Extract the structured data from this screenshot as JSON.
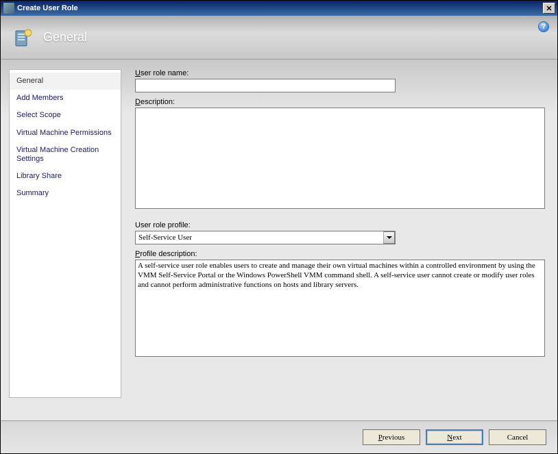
{
  "window": {
    "title": "Create User Role"
  },
  "header": {
    "title": "General",
    "help_icon": "?"
  },
  "sidebar": {
    "items": [
      {
        "label": "General",
        "selected": true
      },
      {
        "label": "Add Members",
        "selected": false
      },
      {
        "label": "Select Scope",
        "selected": false
      },
      {
        "label": "Virtual Machine Permissions",
        "selected": false
      },
      {
        "label": "Virtual Machine Creation Settings",
        "selected": false
      },
      {
        "label": "Library Share",
        "selected": false
      },
      {
        "label": "Summary",
        "selected": false
      }
    ]
  },
  "main": {
    "user_role_name_label": "User role name:",
    "user_role_name_value": "",
    "description_label": "Description:",
    "description_value": "",
    "user_role_profile_label": "User role profile:",
    "user_role_profile_value": "Self-Service User",
    "profile_description_label": "Profile description:",
    "profile_description_value": "A self-service user role enables users to create and manage their own virtual machines within a controlled environment by using the VMM Self-Service Portal or the Windows PowerShell VMM command shell. A self-service user cannot create or modify user roles and cannot perform administrative functions on hosts and library servers."
  },
  "footer": {
    "previous": "Previous",
    "next": "Next",
    "cancel": "Cancel"
  }
}
